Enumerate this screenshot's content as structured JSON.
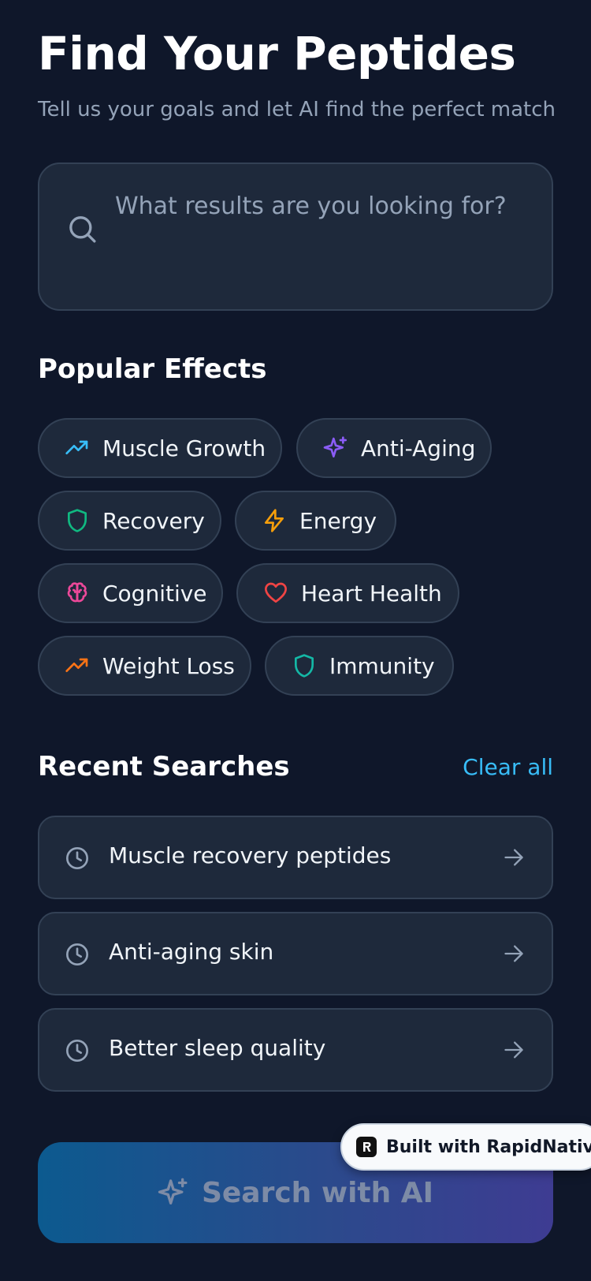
{
  "header": {
    "title": "Find Your Peptides",
    "subtitle": "Tell us your goals and let AI find the perfect match"
  },
  "search": {
    "placeholder": "What results are you looking for?",
    "icon": "search-icon"
  },
  "popular_effects": {
    "title": "Popular Effects",
    "chips": [
      {
        "label": "Muscle Growth",
        "icon": "trending-up-icon",
        "color": "#38bdf8"
      },
      {
        "label": "Anti-Aging",
        "icon": "sparkles-icon",
        "color": "#8b5cf6"
      },
      {
        "label": "Recovery",
        "icon": "shield-icon",
        "color": "#10b981"
      },
      {
        "label": "Energy",
        "icon": "lightning-icon",
        "color": "#f59e0b"
      },
      {
        "label": "Cognitive",
        "icon": "brain-icon",
        "color": "#ec4899"
      },
      {
        "label": "Heart Health",
        "icon": "heart-icon",
        "color": "#ef4444"
      },
      {
        "label": "Weight Loss",
        "icon": "trending-up-icon",
        "color": "#f97316"
      },
      {
        "label": "Immunity",
        "icon": "shield-icon",
        "color": "#14b8a6"
      }
    ]
  },
  "recent_searches": {
    "title": "Recent Searches",
    "clear_label": "Clear all",
    "items": [
      {
        "text": "Muscle recovery peptides"
      },
      {
        "text": "Anti-aging skin"
      },
      {
        "text": "Better sleep quality"
      }
    ]
  },
  "ai_button": {
    "label": "Search with AI",
    "icon": "sparkles-icon"
  },
  "badge": {
    "text": "Built with RapidNative",
    "icon": "rapidnative-logo"
  },
  "colors": {
    "background": "#0f172a",
    "card": "#1e293b",
    "accent": "#38bdf8"
  }
}
